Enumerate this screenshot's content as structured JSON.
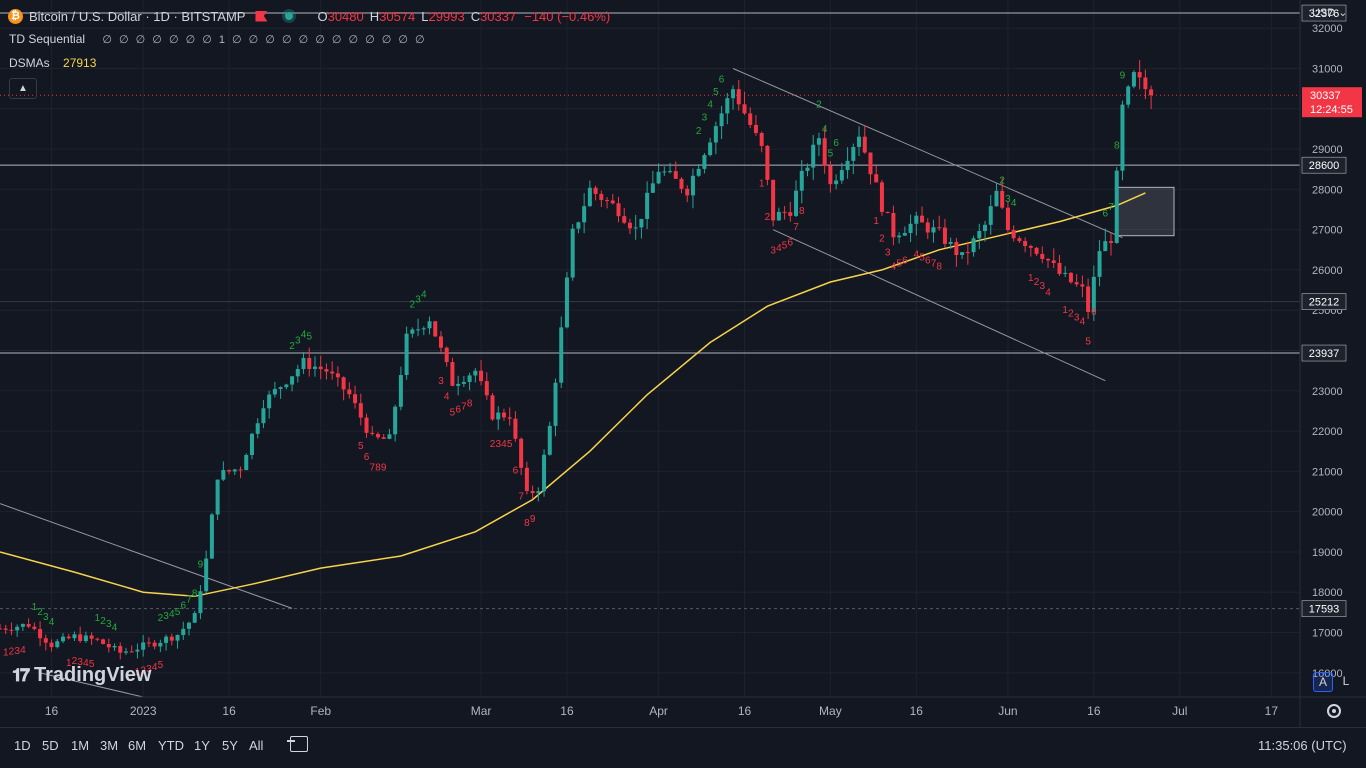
{
  "header": {
    "symbol": "Bitcoin / U.S. Dollar · 1D · BITSTAMP",
    "o_label": "O",
    "o": "30480",
    "h_label": "H",
    "h": "30574",
    "l_label": "L",
    "l": "29993",
    "c_label": "C",
    "c": "30337",
    "change": "−140 (−0.46%)",
    "currency": "USD"
  },
  "indicators": {
    "td_label": "TD Sequential",
    "td_values": "∅ ∅ ∅ ∅ ∅ ∅ ∅ 1 ∅ ∅ ∅ ∅ ∅ ∅ ∅ ∅ ∅ ∅ ∅ ∅",
    "dsma_label": "DSMAs",
    "dsma_value": "27913"
  },
  "toolbar": {
    "ranges": [
      "1D",
      "5D",
      "1M",
      "3M",
      "6M",
      "YTD",
      "1Y",
      "5Y",
      "All"
    ],
    "clock": "11:35:06 (UTC)",
    "auto_label": "A",
    "log_label": "L",
    "logo_text": "TradingView"
  },
  "colors": {
    "bg": "#131722",
    "up": "#26a69a",
    "down": "#f23645",
    "ma": "#f7d44a",
    "hline": "#b2b5be",
    "grid": "#1e222d",
    "td_up": "#22ab3c",
    "td_down": "#f23645"
  },
  "chart_data": {
    "type": "candlestick",
    "yrange": [
      15400,
      32700
    ],
    "y_ticks": [
      16000,
      17000,
      18000,
      19000,
      20000,
      21000,
      22000,
      23000,
      24000,
      25000,
      26000,
      27000,
      28000,
      29000,
      30000,
      31000,
      32000
    ],
    "x_ticks": [
      {
        "label": "16",
        "date": "2022-12-16"
      },
      {
        "label": "2023",
        "date": "2023-01-01"
      },
      {
        "label": "16",
        "date": "2023-01-16"
      },
      {
        "label": "Feb",
        "date": "2023-02-01"
      },
      {
        "label": "Mar",
        "date": "2023-03-01"
      },
      {
        "label": "16",
        "date": "2023-03-16"
      },
      {
        "label": "Apr",
        "date": "2023-04-01"
      },
      {
        "label": "16",
        "date": "2023-04-16"
      },
      {
        "label": "May",
        "date": "2023-05-01"
      },
      {
        "label": "16",
        "date": "2023-05-16"
      },
      {
        "label": "Jun",
        "date": "2023-06-01"
      },
      {
        "label": "16",
        "date": "2023-06-16"
      },
      {
        "label": "Jul",
        "date": "2023-07-01"
      },
      {
        "label": "17",
        "date": "2023-07-17"
      }
    ],
    "price_levels": [
      {
        "value": 32376,
        "label": "32376",
        "style": "solid"
      },
      {
        "value": 28600,
        "label": "28600",
        "style": "solid"
      },
      {
        "value": 25212,
        "label": "25212",
        "style": "faint"
      },
      {
        "value": 23937,
        "label": "23937",
        "style": "solid"
      },
      {
        "value": 17593,
        "label": "17593",
        "style": "dashed"
      }
    ],
    "last_price": {
      "value": 30337,
      "label": "30337",
      "countdown": "12:24:55"
    },
    "trendlines": [
      {
        "from": [
          "2022-12-07",
          20200
        ],
        "to": [
          "2023-01-27",
          17600
        ]
      },
      {
        "from": [
          "2022-12-14",
          16000
        ],
        "to": [
          "2023-01-01",
          15400
        ]
      },
      {
        "from": [
          "2023-04-14",
          31000
        ],
        "to": [
          "2023-06-21",
          26800
        ]
      },
      {
        "from": [
          "2023-04-21",
          27000
        ],
        "to": [
          "2023-06-18",
          23250
        ]
      }
    ],
    "box": {
      "x0": "2023-06-20",
      "x1": "2023-06-30",
      "y0": 26850,
      "y1": 28050
    },
    "ma_series": [
      [
        "2022-12-07",
        19000
      ],
      [
        "2022-12-20",
        18500
      ],
      [
        "2023-01-01",
        18000
      ],
      [
        "2023-01-10",
        17900
      ],
      [
        "2023-01-20",
        18200
      ],
      [
        "2023-02-01",
        18600
      ],
      [
        "2023-02-15",
        18900
      ],
      [
        "2023-02-28",
        19500
      ],
      [
        "2023-03-10",
        20300
      ],
      [
        "2023-03-20",
        21500
      ],
      [
        "2023-03-30",
        22900
      ],
      [
        "2023-04-10",
        24200
      ],
      [
        "2023-04-20",
        25100
      ],
      [
        "2023-05-01",
        25700
      ],
      [
        "2023-05-10",
        26000
      ],
      [
        "2023-05-20",
        26500
      ],
      [
        "2023-06-01",
        26900
      ],
      [
        "2023-06-10",
        27200
      ],
      [
        "2023-06-20",
        27600
      ],
      [
        "2023-06-25",
        27913
      ]
    ],
    "anchors": [
      [
        "2022-12-07",
        17100
      ],
      [
        "2022-12-12",
        17200
      ],
      [
        "2022-12-16",
        16700
      ],
      [
        "2022-12-20",
        16900
      ],
      [
        "2022-12-24",
        16800
      ],
      [
        "2022-12-28",
        16500
      ],
      [
        "2023-01-02",
        16700
      ],
      [
        "2023-01-07",
        16950
      ],
      [
        "2023-01-10",
        17400
      ],
      [
        "2023-01-12",
        18800
      ],
      [
        "2023-01-14",
        20900
      ],
      [
        "2023-01-18",
        21100
      ],
      [
        "2023-01-22",
        22700
      ],
      [
        "2023-01-29",
        23700
      ],
      [
        "2023-02-02",
        23500
      ],
      [
        "2023-02-06",
        22900
      ],
      [
        "2023-02-10",
        21800
      ],
      [
        "2023-02-13",
        21800
      ],
      [
        "2023-02-16",
        24300
      ],
      [
        "2023-02-20",
        24800
      ],
      [
        "2023-02-24",
        23200
      ],
      [
        "2023-02-28",
        23500
      ],
      [
        "2023-03-03",
        22400
      ],
      [
        "2023-03-06",
        22400
      ],
      [
        "2023-03-09",
        20400
      ],
      [
        "2023-03-11",
        20600
      ],
      [
        "2023-03-13",
        22100
      ],
      [
        "2023-03-17",
        26900
      ],
      [
        "2023-03-20",
        28000
      ],
      [
        "2023-03-25",
        27500
      ],
      [
        "2023-03-28",
        27000
      ],
      [
        "2023-04-01",
        28500
      ],
      [
        "2023-04-06",
        28000
      ],
      [
        "2023-04-10",
        29300
      ],
      [
        "2023-04-14",
        30500
      ],
      [
        "2023-04-19",
        29000
      ],
      [
        "2023-04-21",
        27300
      ],
      [
        "2023-04-24",
        27500
      ],
      [
        "2023-04-26",
        28300
      ],
      [
        "2023-04-29",
        29300
      ],
      [
        "2023-05-01",
        28100
      ],
      [
        "2023-05-06",
        29400
      ],
      [
        "2023-05-10",
        27600
      ],
      [
        "2023-05-12",
        26900
      ],
      [
        "2023-05-16",
        27200
      ],
      [
        "2023-05-20",
        26900
      ],
      [
        "2023-05-24",
        26300
      ],
      [
        "2023-05-28",
        27100
      ],
      [
        "2023-05-30",
        27900
      ],
      [
        "2023-06-01",
        27000
      ],
      [
        "2023-06-05",
        26600
      ],
      [
        "2023-06-07",
        26400
      ],
      [
        "2023-06-10",
        25900
      ],
      [
        "2023-06-14",
        25500
      ],
      [
        "2023-06-15",
        25000
      ],
      [
        "2023-06-17",
        26500
      ],
      [
        "2023-06-19",
        26800
      ],
      [
        "2023-06-20",
        28300
      ],
      [
        "2023-06-21",
        30000
      ],
      [
        "2023-06-23",
        30800
      ],
      [
        "2023-06-25",
        30500
      ],
      [
        "2023-06-26",
        30337
      ]
    ],
    "td_counts": [
      {
        "date": "2022-12-13",
        "text": "1234",
        "side": "up"
      },
      {
        "date": "2022-12-24",
        "text": "1234",
        "side": "up"
      },
      {
        "date": "2023-01-04",
        "text": "23456789",
        "side": "up"
      },
      {
        "date": "2023-01-27",
        "text": "2345",
        "side": "up"
      },
      {
        "date": "2023-02-17",
        "text": "234",
        "side": "up"
      },
      {
        "date": "2023-04-08",
        "text": "23456",
        "side": "up"
      },
      {
        "date": "2023-04-29",
        "text": "2456",
        "side": "up"
      },
      {
        "date": "2023-05-31",
        "text": "234",
        "side": "up"
      },
      {
        "date": "2023-06-18",
        "text": "6789",
        "side": "up"
      },
      {
        "date": "2022-12-08",
        "text": "1234",
        "side": "down"
      },
      {
        "date": "2022-12-19",
        "text": "12345",
        "side": "down"
      },
      {
        "date": "2022-12-31",
        "text": "12345",
        "side": "down"
      },
      {
        "date": "2023-02-08",
        "text": "56789",
        "side": "down"
      },
      {
        "date": "2023-02-22",
        "text": "345678",
        "side": "down"
      },
      {
        "date": "2023-03-03",
        "text": "23456789",
        "side": "down"
      },
      {
        "date": "2023-04-19",
        "text": "12345678",
        "side": "down"
      },
      {
        "date": "2023-05-09",
        "text": "123456",
        "side": "down"
      },
      {
        "date": "2023-05-16",
        "text": "45678",
        "side": "down"
      },
      {
        "date": "2023-06-05",
        "text": "1234",
        "side": "down"
      },
      {
        "date": "2023-06-11",
        "text": "123456",
        "side": "down"
      }
    ]
  }
}
